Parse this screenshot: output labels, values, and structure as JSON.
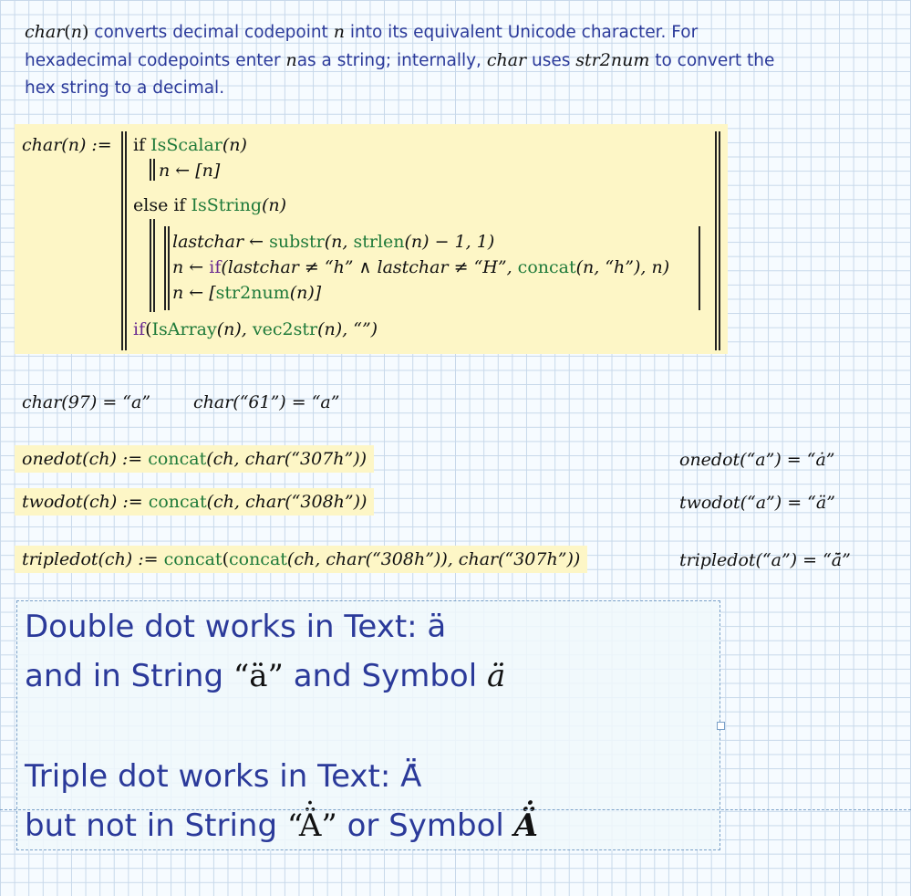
{
  "intro": {
    "p1": "converts decimal codepoint",
    "p2": "into its equivalent Unicode character.  For",
    "p3": "hexadecimal codepoints enter",
    "p4": "as a string; internally,",
    "p5": "uses",
    "p6": "to convert the",
    "p7": "hex string to a decimal.",
    "fn_char": "char",
    "arg_n": "n",
    "fn_str2num": "str2num"
  },
  "definition": {
    "head": "char(n) :=",
    "line1_kw": "if",
    "line1_fn": "IsScalar",
    "line1_arg": "(n)",
    "line2": "n ← [n]",
    "line3_kw": "else if",
    "line3_fn": "IsString",
    "line3_arg": "(n)",
    "line4_a": "lastchar ←",
    "line4_fn1": "substr",
    "line4_b": "(n,",
    "line4_fn2": "strlen",
    "line4_c": "(n) − 1, 1)",
    "line5_a": "n ←",
    "line5_kw": "if",
    "line5_b": "(lastchar ≠ “h” ∧ lastchar ≠ “H”,",
    "line5_fn": "concat",
    "line5_c": "(n, “h”), n)",
    "line6_a": "n ← [",
    "line6_fn": "str2num",
    "line6_b": "(n)]",
    "line7_kw": "if",
    "line7_a": "(",
    "line7_fn1": "IsArray",
    "line7_b": "(n),",
    "line7_fn2": "vec2str",
    "line7_c": "(n), “”)"
  },
  "examples": {
    "ex1": "char(97) = “a”",
    "ex2": "char(“61”) = “a”"
  },
  "onedot": {
    "lhs": "onedot(ch) :=",
    "fn": "concat",
    "rhs": "(ch, char(“307h”))",
    "result": "onedot(“a”) = “ȧ”"
  },
  "twodot": {
    "lhs": "twodot(ch) :=",
    "fn": "concat",
    "rhs": "(ch, char(“308h”))",
    "result": "twodot(“a”) = “ä”"
  },
  "tripledot": {
    "lhs": "tripledot(ch) :=",
    "fn1": "concat",
    "mid1": "(",
    "fn2": "concat",
    "rhs": "(ch, char(“308h”)), char(“307h”))",
    "result": "tripledot(“a”) = “ä̇”"
  },
  "textbox": {
    "l1_text": "Double dot works in Text: ä",
    "l2_a": "and in String",
    "l2_str": "“ä”",
    "l2_b": "and Symbol",
    "l2_sym": "ä",
    "l3_text": "Triple dot works in Text: Ä̇",
    "l4_a": "but not in String",
    "l4_str": "“Ä̇”",
    "l4_b": "or Symbol",
    "l4_sym": "Ä̇"
  },
  "colors": {
    "function_green": "#1f7a3a",
    "keyword_purple": "#6a2c91",
    "text_blue": "#2b3a9a",
    "highlight": "#fdf6c6"
  }
}
